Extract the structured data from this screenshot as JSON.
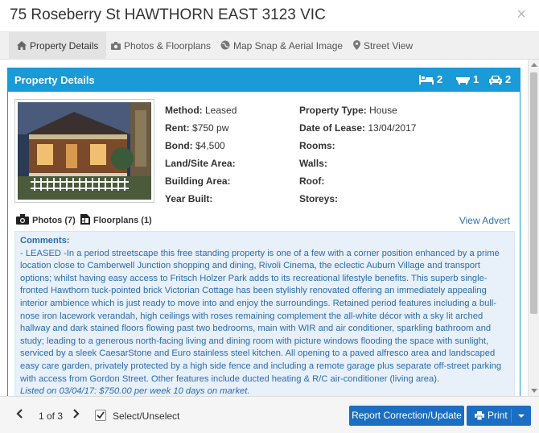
{
  "window": {
    "title": "75 Roseberry St HAWTHORN EAST 3123 VIC",
    "close_icon": "close-icon"
  },
  "tabs": [
    {
      "label": "Property Details",
      "icon": "home-icon",
      "active": true
    },
    {
      "label": "Photos & Floorplans",
      "icon": "camera-icon",
      "active": false
    },
    {
      "label": "Map Snap & Aerial Image",
      "icon": "globe-icon",
      "active": false
    },
    {
      "label": "Street View",
      "icon": "map-marker-icon",
      "active": false
    }
  ],
  "panel": {
    "title": "Property Details",
    "beds": "2",
    "baths": "1",
    "cars": "2"
  },
  "details": {
    "method_label": "Method:",
    "method_value": "Leased",
    "rent_label": "Rent:",
    "rent_value": "$750 pw",
    "bond_label": "Bond:",
    "bond_value": "$4,500",
    "land_label": "Land/Site Area:",
    "land_value": "",
    "building_label": "Building Area:",
    "building_value": "",
    "year_label": "Year Built:",
    "year_value": "",
    "type_label": "Property Type:",
    "type_value": "House",
    "lease_date_label": "Date of Lease:",
    "lease_date_value": "13/04/2017",
    "rooms_label": "Rooms:",
    "rooms_value": "",
    "walls_label": "Walls:",
    "walls_value": "",
    "roof_label": "Roof:",
    "roof_value": "",
    "storeys_label": "Storeys:",
    "storeys_value": ""
  },
  "media": {
    "photos_label": "Photos (7)",
    "floorplans_label": "Floorplans (1)",
    "view_advert": "View Advert"
  },
  "comments": {
    "label": "Comments:",
    "text": "- LEASED -In a period streetscape this free standing property is one of a few with a corner position enhanced by a prime location close to Camberwell Junction shopping and dining, Rivoli Cinema, the eclectic Auburn Village and transport options; whilst having easy access to Fritsch Holzer Park adds to its recreational lifestyle benefits. This superb single-fronted Hawthorn tuck-pointed brick Victorian Cottage has been stylishly renovated offering an immediately appealing interior ambience which is just ready to move into and enjoy the surroundings. Retained period features including a bull-nose iron lacework verandah, high ceilings with roses remaining complement the all-white décor with a sky lit arched hallway and dark stained floors flowing past two bedrooms, main with WIR and air conditioner, sparkling bathroom and study; leading to a generous north-facing living and dining room with picture windows flooding the space with sunlight, serviced by a sleek CaesarStone and Euro stainless steel kitchen. All opening to a paved alfresco area and landscaped easy care garden, privately protected by a high side fence and including a remote garage plus separate off-street parking with access from Gordon Street. Other features include ducted heating & R/C air-conditioner (living area).",
    "listed": "Listed on 03/04/17: $750.00 per week 10 days on market."
  },
  "footer": {
    "page_text": "1 of 3",
    "select_label": "Select/Unselect",
    "report_label": "Report Correction/Update",
    "print_label": "Print"
  },
  "colors": {
    "accent": "#1a9ad6",
    "button": "#1b6ec2",
    "comment_bg": "#e8f0fa",
    "comment_text": "#2b6cb0",
    "link": "#2a74b5"
  }
}
